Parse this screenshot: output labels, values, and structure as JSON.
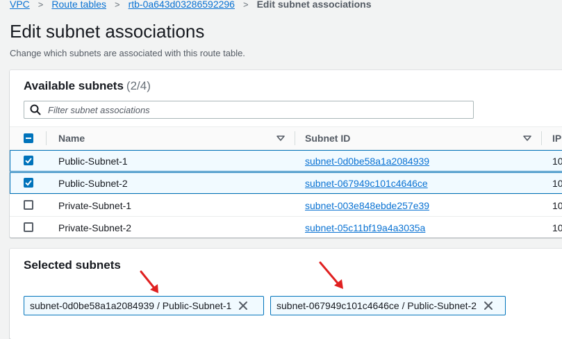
{
  "breadcrumb": {
    "items": [
      "VPC",
      "Route tables",
      "rtb-0a643d03286592296"
    ],
    "current": "Edit subnet associations"
  },
  "page": {
    "title": "Edit subnet associations",
    "description": "Change which subnets are associated with this route table."
  },
  "available": {
    "title": "Available subnets",
    "count": "(2/4)",
    "filter_placeholder": "Filter subnet associations",
    "columns": [
      "Name",
      "Subnet ID",
      "IP"
    ],
    "rows": [
      {
        "name": "Public-Subnet-1",
        "subnet_id": "subnet-0d0be58a1a2084939",
        "ip": "10",
        "checked": true
      },
      {
        "name": "Public-Subnet-2",
        "subnet_id": "subnet-067949c101c4646ce",
        "ip": "10",
        "checked": true
      },
      {
        "name": "Private-Subnet-1",
        "subnet_id": "subnet-003e848ebde257e39",
        "ip": "10",
        "checked": false
      },
      {
        "name": "Private-Subnet-2",
        "subnet_id": "subnet-05c11bf19a4a3035a",
        "ip": "10",
        "checked": false
      }
    ]
  },
  "selected": {
    "title": "Selected subnets",
    "tokens": [
      "subnet-0d0be58a1a2084939 / Public-Subnet-1",
      "subnet-067949c101c4646ce / Public-Subnet-2"
    ]
  },
  "icons": {
    "search": "search-icon",
    "sort": "caret-down-icon",
    "close": "close-icon",
    "annotation": "red-arrow-icon"
  },
  "colors": {
    "link": "#0972d3",
    "accent": "#0073bb",
    "selected_row": "#f1faff",
    "annotation_arrow": "#e02020"
  }
}
